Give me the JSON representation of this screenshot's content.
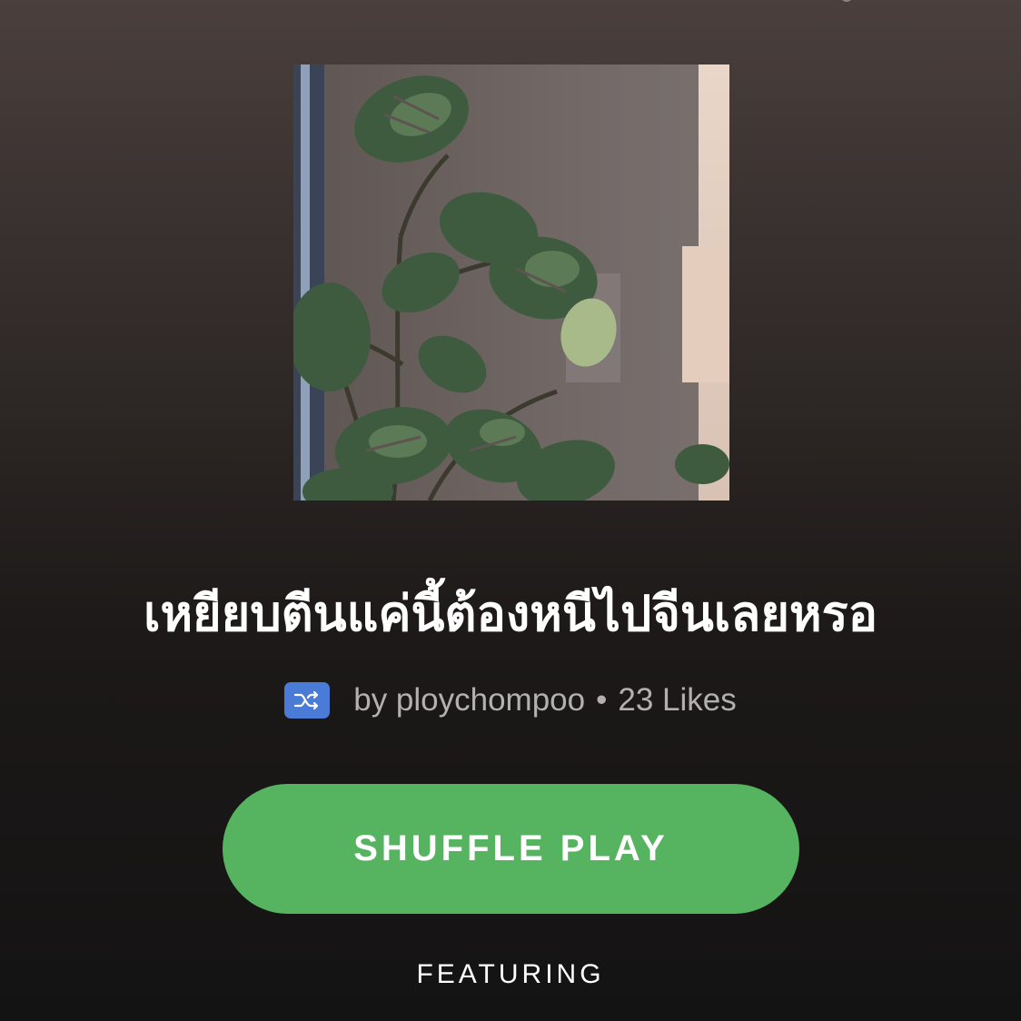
{
  "playlist": {
    "title": "เหยียบตีนแค่นี้ต้องหนีไปจีนเลยหรอ",
    "cover_image": "monstera-plant-photo",
    "owner_text": "by ploychompoo",
    "separator": "•",
    "likes_text": "23 Likes",
    "shuffle_icon": "shuffle-icon"
  },
  "actions": {
    "shuffle_play_label": "SHUFFLE PLAY"
  },
  "section": {
    "featuring_label": "FEATURING"
  },
  "colors": {
    "accent_green": "#56b460",
    "shuffle_badge_blue": "#4a7bd6",
    "meta_text": "#b3b0ae"
  }
}
